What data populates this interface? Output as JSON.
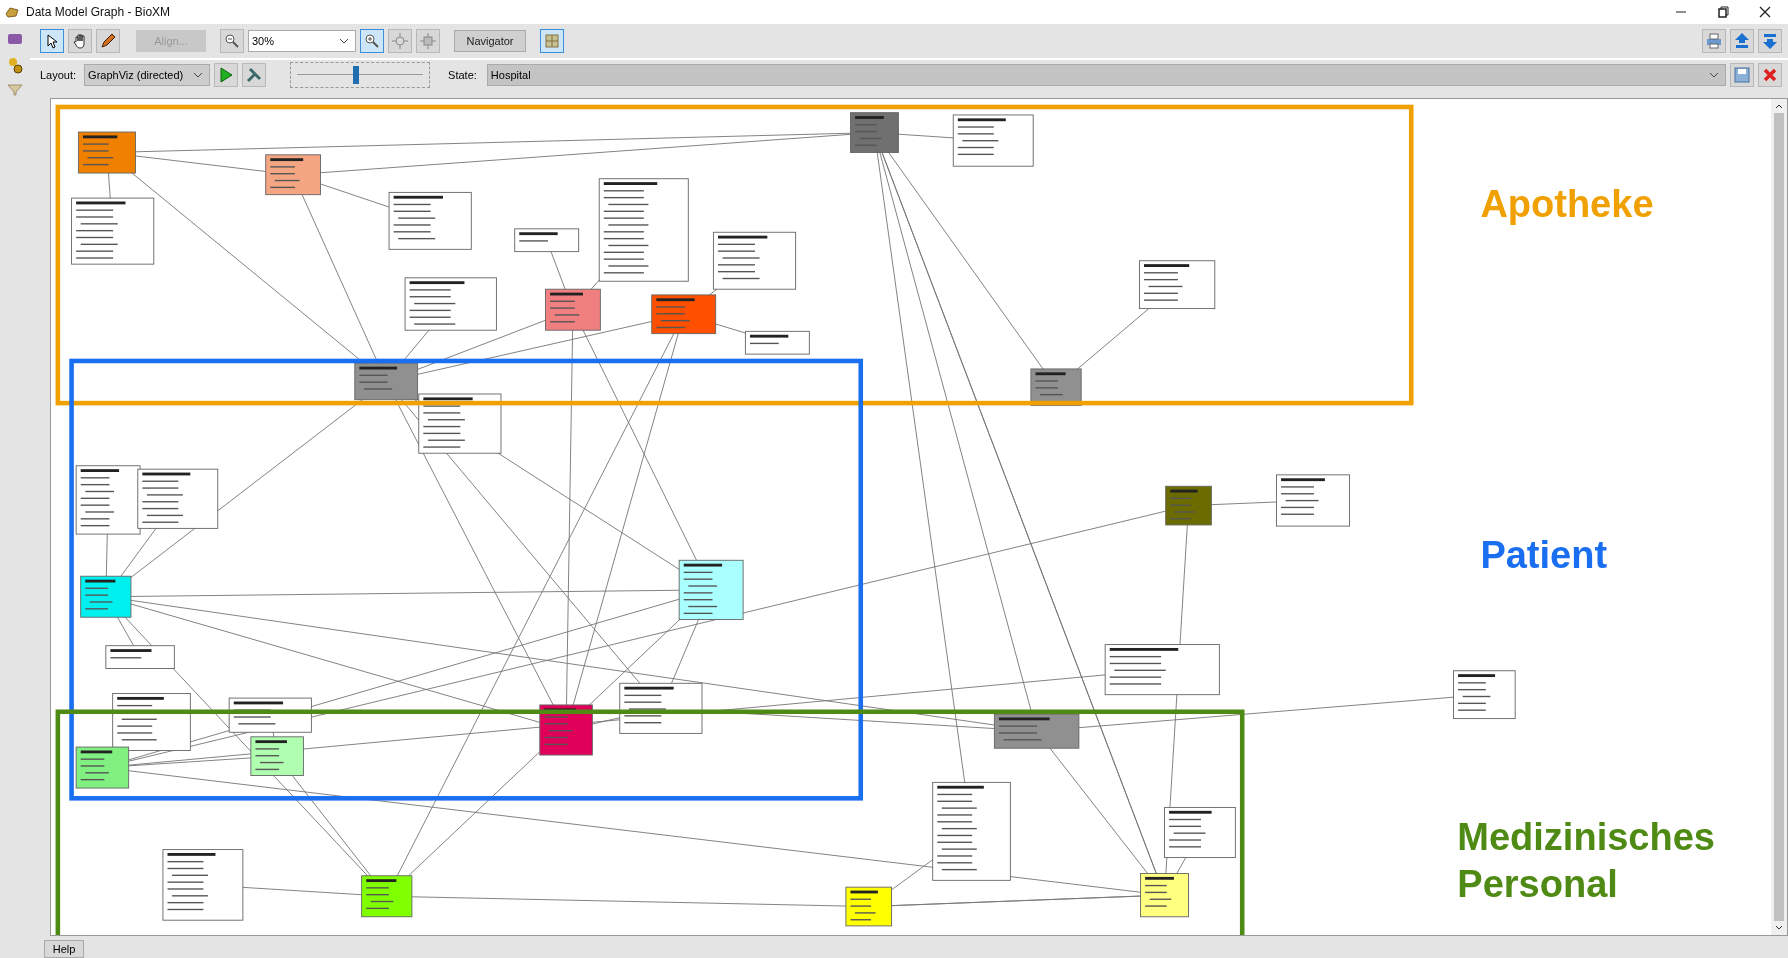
{
  "window": {
    "title": "Data Model Graph - BioXM"
  },
  "toolbar": {
    "tools": [
      {
        "kind": "pointer",
        "selected": true
      },
      {
        "kind": "hand",
        "selected": false
      },
      {
        "kind": "pencil",
        "selected": false
      }
    ],
    "align_button": {
      "label": "Align...",
      "disabled": true
    },
    "zoom": {
      "value": "30%"
    },
    "navigator_button": {
      "label": "Navigator"
    },
    "grid_toggle": {
      "on": true
    }
  },
  "layout_bar": {
    "layout_label": "Layout:",
    "layout_value": "GraphViz (directed)",
    "slider": {
      "level": 0.47
    },
    "state_label": "State:",
    "state_value": "Hospital"
  },
  "groups": [
    {
      "label": "Apotheke",
      "color": "#f0a000"
    },
    {
      "label": "Patient",
      "color": "#1a6ef0"
    },
    {
      "label": "Medizinisches Personal",
      "color": "#4e8a14"
    }
  ],
  "status_bar": {
    "help_button": "Help"
  }
}
